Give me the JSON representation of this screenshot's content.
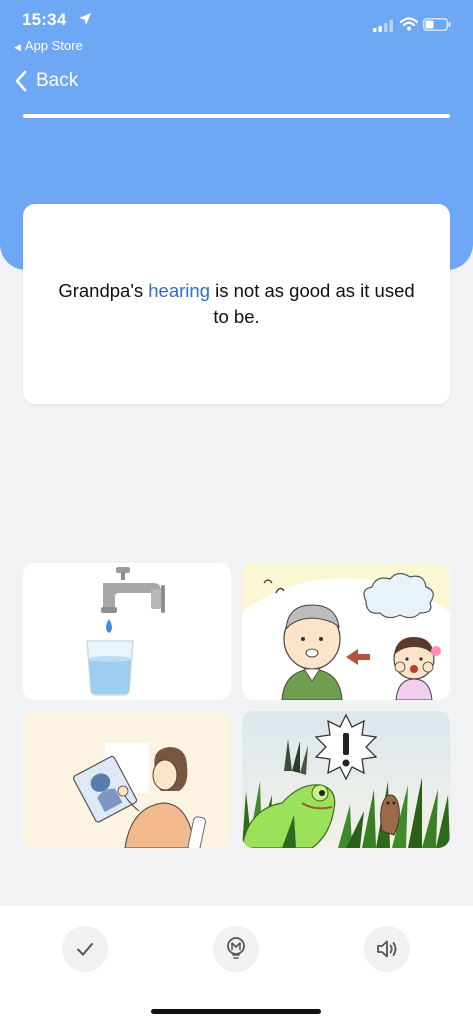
{
  "status_bar": {
    "time": "15:34",
    "back_app_label": "App Store"
  },
  "nav": {
    "back_label": "Back",
    "progress_fraction": 1.0
  },
  "prompt": {
    "before": "Grandpa's ",
    "highlight": "hearing",
    "after": " is not as good as it used to be.",
    "highlight_color": "#2f6fc9"
  },
  "choices": [
    {
      "icon": "faucet-water-glass-image"
    },
    {
      "icon": "grandpa-girl-calling-image"
    },
    {
      "icon": "woman-looking-at-xray-image"
    },
    {
      "icon": "frog-grass-exclamation-image"
    }
  ],
  "toolbar": {
    "buttons": [
      "check-icon",
      "hint-bulb-icon",
      "speaker-icon"
    ]
  },
  "colors": {
    "header_blue": "#6ea8f5",
    "page_bg": "#f1f2f4",
    "card_bg": "#ffffff"
  }
}
